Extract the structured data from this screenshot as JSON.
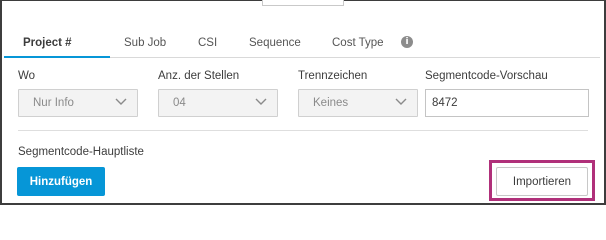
{
  "tabs": [
    {
      "label": "Project #",
      "active": true
    },
    {
      "label": "Sub Job",
      "active": false
    },
    {
      "label": "CSI",
      "active": false
    },
    {
      "label": "Sequence",
      "active": false
    },
    {
      "label": "Cost Type",
      "active": false
    }
  ],
  "info_icon_glyph": "i",
  "fields": {
    "wo": {
      "label": "Wo",
      "value": "Nur Info"
    },
    "digits": {
      "label": "Anz. der Stellen",
      "value": "04"
    },
    "separator": {
      "label": "Trennzeichen",
      "value": "Keines"
    },
    "preview": {
      "label": "Segmentcode-Vorschau",
      "value": "8472"
    }
  },
  "master_list": {
    "label": "Segmentcode-Hauptliste",
    "add_label": "Hinzufügen",
    "import_label": "Importieren"
  },
  "colors": {
    "accent": "#0696d7",
    "highlight": "#b0307a"
  }
}
